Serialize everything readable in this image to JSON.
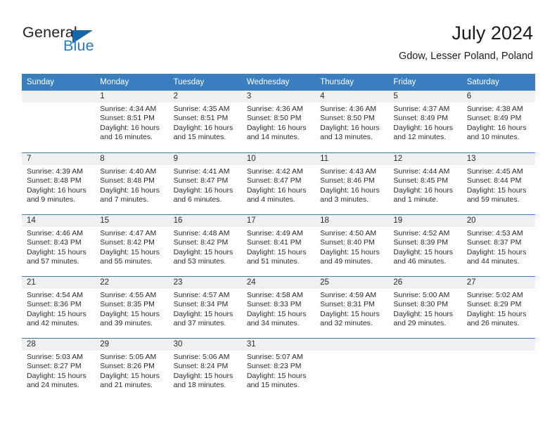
{
  "brand": {
    "name_part1": "General",
    "name_part2": "Blue"
  },
  "header": {
    "title": "July 2024",
    "location": "Gdow, Lesser Poland, Poland"
  },
  "weekdays": [
    "Sunday",
    "Monday",
    "Tuesday",
    "Wednesday",
    "Thursday",
    "Friday",
    "Saturday"
  ],
  "colors": {
    "header_blue": "#3a7ebf",
    "logo_blue": "#2a7bc0",
    "day_band": "#f0f0f0",
    "text": "#2b2b2b"
  },
  "weeks": [
    [
      {
        "day": "",
        "blank": true
      },
      {
        "day": "1",
        "sunrise": "Sunrise: 4:34 AM",
        "sunset": "Sunset: 8:51 PM",
        "daylight1": "Daylight: 16 hours",
        "daylight2": "and 16 minutes."
      },
      {
        "day": "2",
        "sunrise": "Sunrise: 4:35 AM",
        "sunset": "Sunset: 8:51 PM",
        "daylight1": "Daylight: 16 hours",
        "daylight2": "and 15 minutes."
      },
      {
        "day": "3",
        "sunrise": "Sunrise: 4:36 AM",
        "sunset": "Sunset: 8:50 PM",
        "daylight1": "Daylight: 16 hours",
        "daylight2": "and 14 minutes."
      },
      {
        "day": "4",
        "sunrise": "Sunrise: 4:36 AM",
        "sunset": "Sunset: 8:50 PM",
        "daylight1": "Daylight: 16 hours",
        "daylight2": "and 13 minutes."
      },
      {
        "day": "5",
        "sunrise": "Sunrise: 4:37 AM",
        "sunset": "Sunset: 8:49 PM",
        "daylight1": "Daylight: 16 hours",
        "daylight2": "and 12 minutes."
      },
      {
        "day": "6",
        "sunrise": "Sunrise: 4:38 AM",
        "sunset": "Sunset: 8:49 PM",
        "daylight1": "Daylight: 16 hours",
        "daylight2": "and 10 minutes."
      }
    ],
    [
      {
        "day": "7",
        "sunrise": "Sunrise: 4:39 AM",
        "sunset": "Sunset: 8:48 PM",
        "daylight1": "Daylight: 16 hours",
        "daylight2": "and 9 minutes."
      },
      {
        "day": "8",
        "sunrise": "Sunrise: 4:40 AM",
        "sunset": "Sunset: 8:48 PM",
        "daylight1": "Daylight: 16 hours",
        "daylight2": "and 7 minutes."
      },
      {
        "day": "9",
        "sunrise": "Sunrise: 4:41 AM",
        "sunset": "Sunset: 8:47 PM",
        "daylight1": "Daylight: 16 hours",
        "daylight2": "and 6 minutes."
      },
      {
        "day": "10",
        "sunrise": "Sunrise: 4:42 AM",
        "sunset": "Sunset: 8:47 PM",
        "daylight1": "Daylight: 16 hours",
        "daylight2": "and 4 minutes."
      },
      {
        "day": "11",
        "sunrise": "Sunrise: 4:43 AM",
        "sunset": "Sunset: 8:46 PM",
        "daylight1": "Daylight: 16 hours",
        "daylight2": "and 3 minutes."
      },
      {
        "day": "12",
        "sunrise": "Sunrise: 4:44 AM",
        "sunset": "Sunset: 8:45 PM",
        "daylight1": "Daylight: 16 hours",
        "daylight2": "and 1 minute."
      },
      {
        "day": "13",
        "sunrise": "Sunrise: 4:45 AM",
        "sunset": "Sunset: 8:44 PM",
        "daylight1": "Daylight: 15 hours",
        "daylight2": "and 59 minutes."
      }
    ],
    [
      {
        "day": "14",
        "sunrise": "Sunrise: 4:46 AM",
        "sunset": "Sunset: 8:43 PM",
        "daylight1": "Daylight: 15 hours",
        "daylight2": "and 57 minutes."
      },
      {
        "day": "15",
        "sunrise": "Sunrise: 4:47 AM",
        "sunset": "Sunset: 8:42 PM",
        "daylight1": "Daylight: 15 hours",
        "daylight2": "and 55 minutes."
      },
      {
        "day": "16",
        "sunrise": "Sunrise: 4:48 AM",
        "sunset": "Sunset: 8:42 PM",
        "daylight1": "Daylight: 15 hours",
        "daylight2": "and 53 minutes."
      },
      {
        "day": "17",
        "sunrise": "Sunrise: 4:49 AM",
        "sunset": "Sunset: 8:41 PM",
        "daylight1": "Daylight: 15 hours",
        "daylight2": "and 51 minutes."
      },
      {
        "day": "18",
        "sunrise": "Sunrise: 4:50 AM",
        "sunset": "Sunset: 8:40 PM",
        "daylight1": "Daylight: 15 hours",
        "daylight2": "and 49 minutes."
      },
      {
        "day": "19",
        "sunrise": "Sunrise: 4:52 AM",
        "sunset": "Sunset: 8:39 PM",
        "daylight1": "Daylight: 15 hours",
        "daylight2": "and 46 minutes."
      },
      {
        "day": "20",
        "sunrise": "Sunrise: 4:53 AM",
        "sunset": "Sunset: 8:37 PM",
        "daylight1": "Daylight: 15 hours",
        "daylight2": "and 44 minutes."
      }
    ],
    [
      {
        "day": "21",
        "sunrise": "Sunrise: 4:54 AM",
        "sunset": "Sunset: 8:36 PM",
        "daylight1": "Daylight: 15 hours",
        "daylight2": "and 42 minutes."
      },
      {
        "day": "22",
        "sunrise": "Sunrise: 4:55 AM",
        "sunset": "Sunset: 8:35 PM",
        "daylight1": "Daylight: 15 hours",
        "daylight2": "and 39 minutes."
      },
      {
        "day": "23",
        "sunrise": "Sunrise: 4:57 AM",
        "sunset": "Sunset: 8:34 PM",
        "daylight1": "Daylight: 15 hours",
        "daylight2": "and 37 minutes."
      },
      {
        "day": "24",
        "sunrise": "Sunrise: 4:58 AM",
        "sunset": "Sunset: 8:33 PM",
        "daylight1": "Daylight: 15 hours",
        "daylight2": "and 34 minutes."
      },
      {
        "day": "25",
        "sunrise": "Sunrise: 4:59 AM",
        "sunset": "Sunset: 8:31 PM",
        "daylight1": "Daylight: 15 hours",
        "daylight2": "and 32 minutes."
      },
      {
        "day": "26",
        "sunrise": "Sunrise: 5:00 AM",
        "sunset": "Sunset: 8:30 PM",
        "daylight1": "Daylight: 15 hours",
        "daylight2": "and 29 minutes."
      },
      {
        "day": "27",
        "sunrise": "Sunrise: 5:02 AM",
        "sunset": "Sunset: 8:29 PM",
        "daylight1": "Daylight: 15 hours",
        "daylight2": "and 26 minutes."
      }
    ],
    [
      {
        "day": "28",
        "sunrise": "Sunrise: 5:03 AM",
        "sunset": "Sunset: 8:27 PM",
        "daylight1": "Daylight: 15 hours",
        "daylight2": "and 24 minutes."
      },
      {
        "day": "29",
        "sunrise": "Sunrise: 5:05 AM",
        "sunset": "Sunset: 8:26 PM",
        "daylight1": "Daylight: 15 hours",
        "daylight2": "and 21 minutes."
      },
      {
        "day": "30",
        "sunrise": "Sunrise: 5:06 AM",
        "sunset": "Sunset: 8:24 PM",
        "daylight1": "Daylight: 15 hours",
        "daylight2": "and 18 minutes."
      },
      {
        "day": "31",
        "sunrise": "Sunrise: 5:07 AM",
        "sunset": "Sunset: 8:23 PM",
        "daylight1": "Daylight: 15 hours",
        "daylight2": "and 15 minutes."
      },
      {
        "day": "",
        "blank": true
      },
      {
        "day": "",
        "blank": true
      },
      {
        "day": "",
        "blank": true
      }
    ]
  ]
}
